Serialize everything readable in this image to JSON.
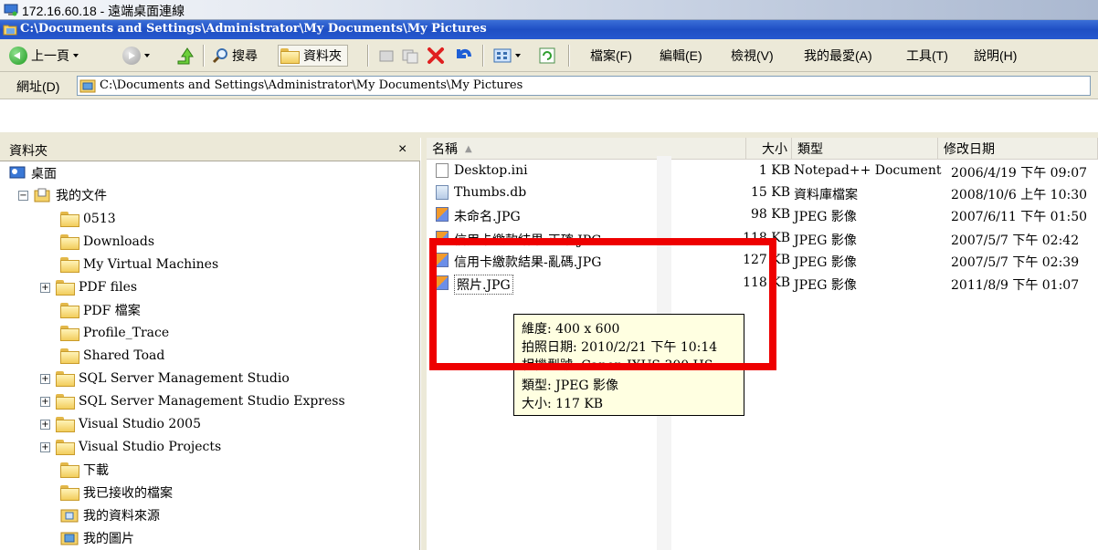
{
  "rdp": {
    "title": "172.16.60.18 - 遠端桌面連線"
  },
  "window": {
    "title": "C:\\Documents and Settings\\Administrator\\My Documents\\My Pictures"
  },
  "toolbar": {
    "back": "上一頁",
    "search": "搜尋",
    "folders": "資料夾",
    "menus": [
      "檔案(F)",
      "編輯(E)",
      "檢視(V)",
      "我的最愛(A)",
      "工具(T)",
      "說明(H)"
    ]
  },
  "address": {
    "label": "網址(D)",
    "value": "C:\\Documents and Settings\\Administrator\\My Documents\\My Pictures"
  },
  "left_pane": {
    "title": "資料夾",
    "close": "×",
    "tree": [
      {
        "label": "桌面",
        "plus": ""
      },
      {
        "label": "我的文件",
        "plus": "−"
      },
      {
        "label": "0513",
        "plus": ""
      },
      {
        "label": "Downloads",
        "plus": ""
      },
      {
        "label": "My Virtual Machines",
        "plus": ""
      },
      {
        "label": "PDF files",
        "plus": "+"
      },
      {
        "label": "PDF 檔案",
        "plus": ""
      },
      {
        "label": "Profile_Trace",
        "plus": ""
      },
      {
        "label": "Shared Toad",
        "plus": ""
      },
      {
        "label": "SQL Server Management Studio",
        "plus": "+"
      },
      {
        "label": "SQL Server Management Studio Express",
        "plus": "+"
      },
      {
        "label": "Visual Studio 2005",
        "plus": "+"
      },
      {
        "label": "Visual Studio Projects",
        "plus": "+"
      },
      {
        "label": "下載",
        "plus": ""
      },
      {
        "label": "我已接收的檔案",
        "plus": ""
      },
      {
        "label": "我的資料來源",
        "plus": ""
      },
      {
        "label": "我的圖片",
        "plus": ""
      }
    ]
  },
  "columns": {
    "name": "名稱",
    "size": "大小",
    "type": "類型",
    "modified": "修改日期"
  },
  "files": [
    {
      "name": "Desktop.ini",
      "size": "1 KB",
      "type": "Notepad++ Document",
      "modified": "2006/4/19 下午 09:07"
    },
    {
      "name": "Thumbs.db",
      "size": "15 KB",
      "type": "資料庫檔案",
      "modified": "2008/10/6 上午 10:30"
    },
    {
      "name": "未命名.JPG",
      "size": "98 KB",
      "type": "JPEG 影像",
      "modified": "2007/6/11 下午 01:50"
    },
    {
      "name": "信用卡繳款結果-正確.JPG",
      "size": "118 KB",
      "type": "JPEG 影像",
      "modified": "2007/5/7 下午 02:42"
    },
    {
      "name": "信用卡繳款結果-亂碼.JPG",
      "size": "127 KB",
      "type": "JPEG 影像",
      "modified": "2007/5/7 下午 02:39"
    },
    {
      "name": "照片.JPG",
      "size": "118 KB",
      "type": "JPEG 影像",
      "modified": "2011/8/9 下午 01:07"
    }
  ],
  "tooltip": {
    "dimensions": "維度: 400 x 600",
    "date_taken": "拍照日期: 2010/2/21 下午 10:14",
    "camera": "相機型號: Canon IXUS 300 HS",
    "type": "類型: JPEG 影像",
    "size": "大小: 117 KB"
  },
  "colors": {
    "highlight_box": "#ee0000",
    "title_bar": "#2658cf",
    "tooltip_bg": "#ffffe1"
  }
}
